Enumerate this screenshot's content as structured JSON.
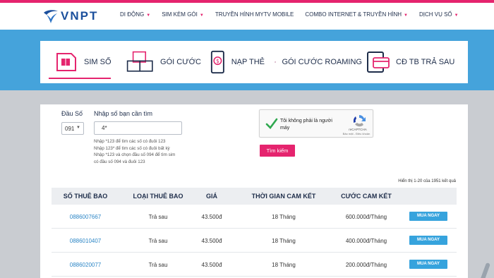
{
  "brand": {
    "name": "VNPT",
    "color": "#1b4f9c",
    "accent": "#e5246e",
    "blue": "#45a3db"
  },
  "nav": [
    {
      "label": "DI ĐỘNG",
      "dropdown": true
    },
    {
      "label": "SIM KÈM GÓI",
      "dropdown": true
    },
    {
      "label": "TRUYỀN HÌNH MYTV MOBILE",
      "dropdown": false
    },
    {
      "label": "COMBO INTERNET & TRUYỀN HÌNH",
      "dropdown": true
    },
    {
      "label": "DỊCH VỤ SỐ",
      "dropdown": true
    }
  ],
  "tabs": [
    {
      "label": "SIM SỐ",
      "icon": "sim-card-icon",
      "active": true
    },
    {
      "label": "GÓI CƯỚC",
      "icon": "package-boxes-icon",
      "active": false
    },
    {
      "label": "NẠP THẺ",
      "icon": "phone-topup-icon",
      "active": false
    },
    {
      "label": "GÓI CƯỚC ROAMING",
      "icon": "roaming-icon",
      "active": false
    },
    {
      "label": "CĐ TB TRẢ SAU",
      "icon": "postpaid-card-icon",
      "active": false
    }
  ],
  "search": {
    "prefix_label": "Đầu Số",
    "prefix_value": "091",
    "number_label": "Nhập số bạn cần tìm",
    "number_value": "4*",
    "hint_lines": [
      "Nhập *123 để tìm các số có đuôi 123",
      "Nhập 123* để tìm các số có đuôi bất kỳ",
      "Nhập *123 và chọn đầu số 094 để tìm sim",
      "có đầu số 094 và đuôi 123"
    ],
    "button_label": "Tìm kiếm"
  },
  "captcha": {
    "text": "Tôi không phải là người máy",
    "brand": "reCAPTCHA",
    "links": "Bảo mật - Điều khoản"
  },
  "results": {
    "count_text": "Hiển thị 1-20 của 1951 kết quả",
    "columns": [
      "SỐ THUÊ BAO",
      "LOẠI THUÊ BAO",
      "GIÁ",
      "THỜI GIAN CAM KẾT",
      "CƯỚC CAM KẾT"
    ],
    "rows": [
      {
        "phone": "0886007667",
        "type": "Trả sau",
        "price": "43.500đ",
        "commit_time": "18 Tháng",
        "commit_fee": "600.000đ/Tháng",
        "buy": "MUA NGAY"
      },
      {
        "phone": "0886010407",
        "type": "Trả sau",
        "price": "43.500đ",
        "commit_time": "18 Tháng",
        "commit_fee": "400.000đ/Tháng",
        "buy": "MUA NGAY"
      },
      {
        "phone": "0886020077",
        "type": "Trả sau",
        "price": "43.500đ",
        "commit_time": "18 Tháng",
        "commit_fee": "200.000đ/Tháng",
        "buy": "MUA NGAY"
      }
    ]
  }
}
